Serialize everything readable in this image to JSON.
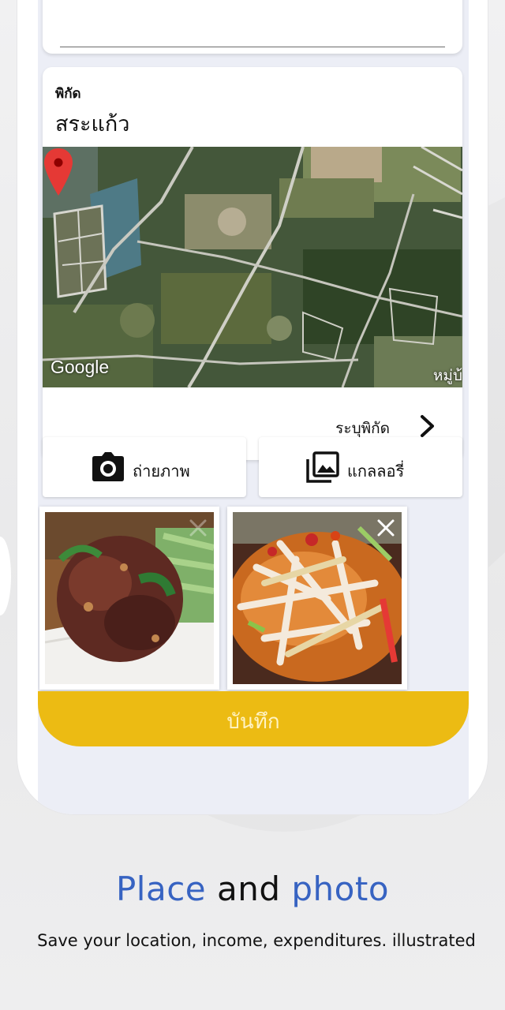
{
  "location": {
    "label": "พิกัด",
    "name": "สระแก้ว",
    "map": {
      "attribution": "Google",
      "corner_text": "หมู่บ้",
      "pin_color": "#e53935"
    },
    "specify_label": "ระบุพิกัด"
  },
  "actions": {
    "camera_label": "ถ่ายภาพ",
    "gallery_label": "แกลลอรี่"
  },
  "photos": [
    {
      "description": "food-photo-1"
    },
    {
      "description": "food-photo-2"
    }
  ],
  "save_button": {
    "label": "บันทึก",
    "color": "#ecbb13"
  },
  "promo": {
    "headline_part1": "Place",
    "headline_part2": "and",
    "headline_part3": "photo",
    "subtitle": "Save your location, income, expenditures. illustrated",
    "accent_color": "#3763c2"
  }
}
